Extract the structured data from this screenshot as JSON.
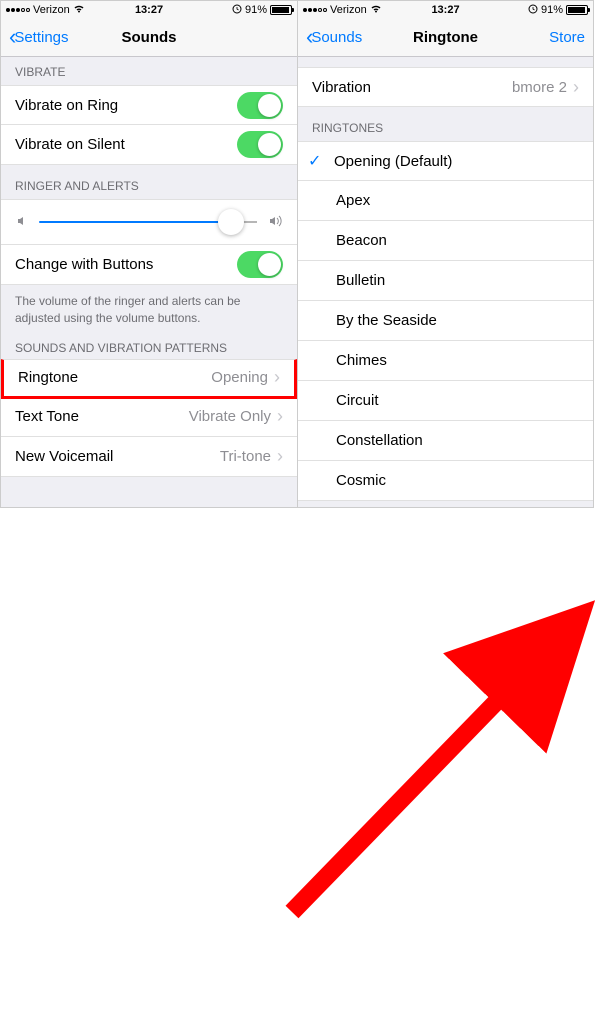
{
  "status": {
    "carrier": "Verizon",
    "time": "13:27",
    "battery": "91%"
  },
  "left": {
    "back": "Settings",
    "title": "Sounds",
    "sections": {
      "vibrate": "VIBRATE",
      "ringer": "RINGER AND ALERTS",
      "patterns": "SOUNDS AND VIBRATION PATTERNS"
    },
    "rows": {
      "vibrateRing": "Vibrate on Ring",
      "vibrateSilent": "Vibrate on Silent",
      "changeButtons": "Change with Buttons",
      "ringtone": "Ringtone",
      "ringtoneVal": "Opening",
      "textTone": "Text Tone",
      "textToneVal": "Vibrate Only",
      "voicemail": "New Voicemail",
      "voicemailVal": "Tri-tone"
    },
    "note": "The volume of the ringer and alerts can be adjusted using the volume buttons."
  },
  "right": {
    "back": "Sounds",
    "title": "Ringtone",
    "store": "Store",
    "vibration": "Vibration",
    "vibrationVal": "bmore 2",
    "ringtonesHeader": "RINGTONES",
    "items": {
      "opening": "Opening (Default)",
      "apex": "Apex",
      "beacon": "Beacon",
      "bulletin": "Bulletin",
      "seaside": "By the Seaside",
      "chimes": "Chimes",
      "circuit": "Circuit",
      "constellation": "Constellation",
      "cosmic": "Cosmic"
    }
  }
}
